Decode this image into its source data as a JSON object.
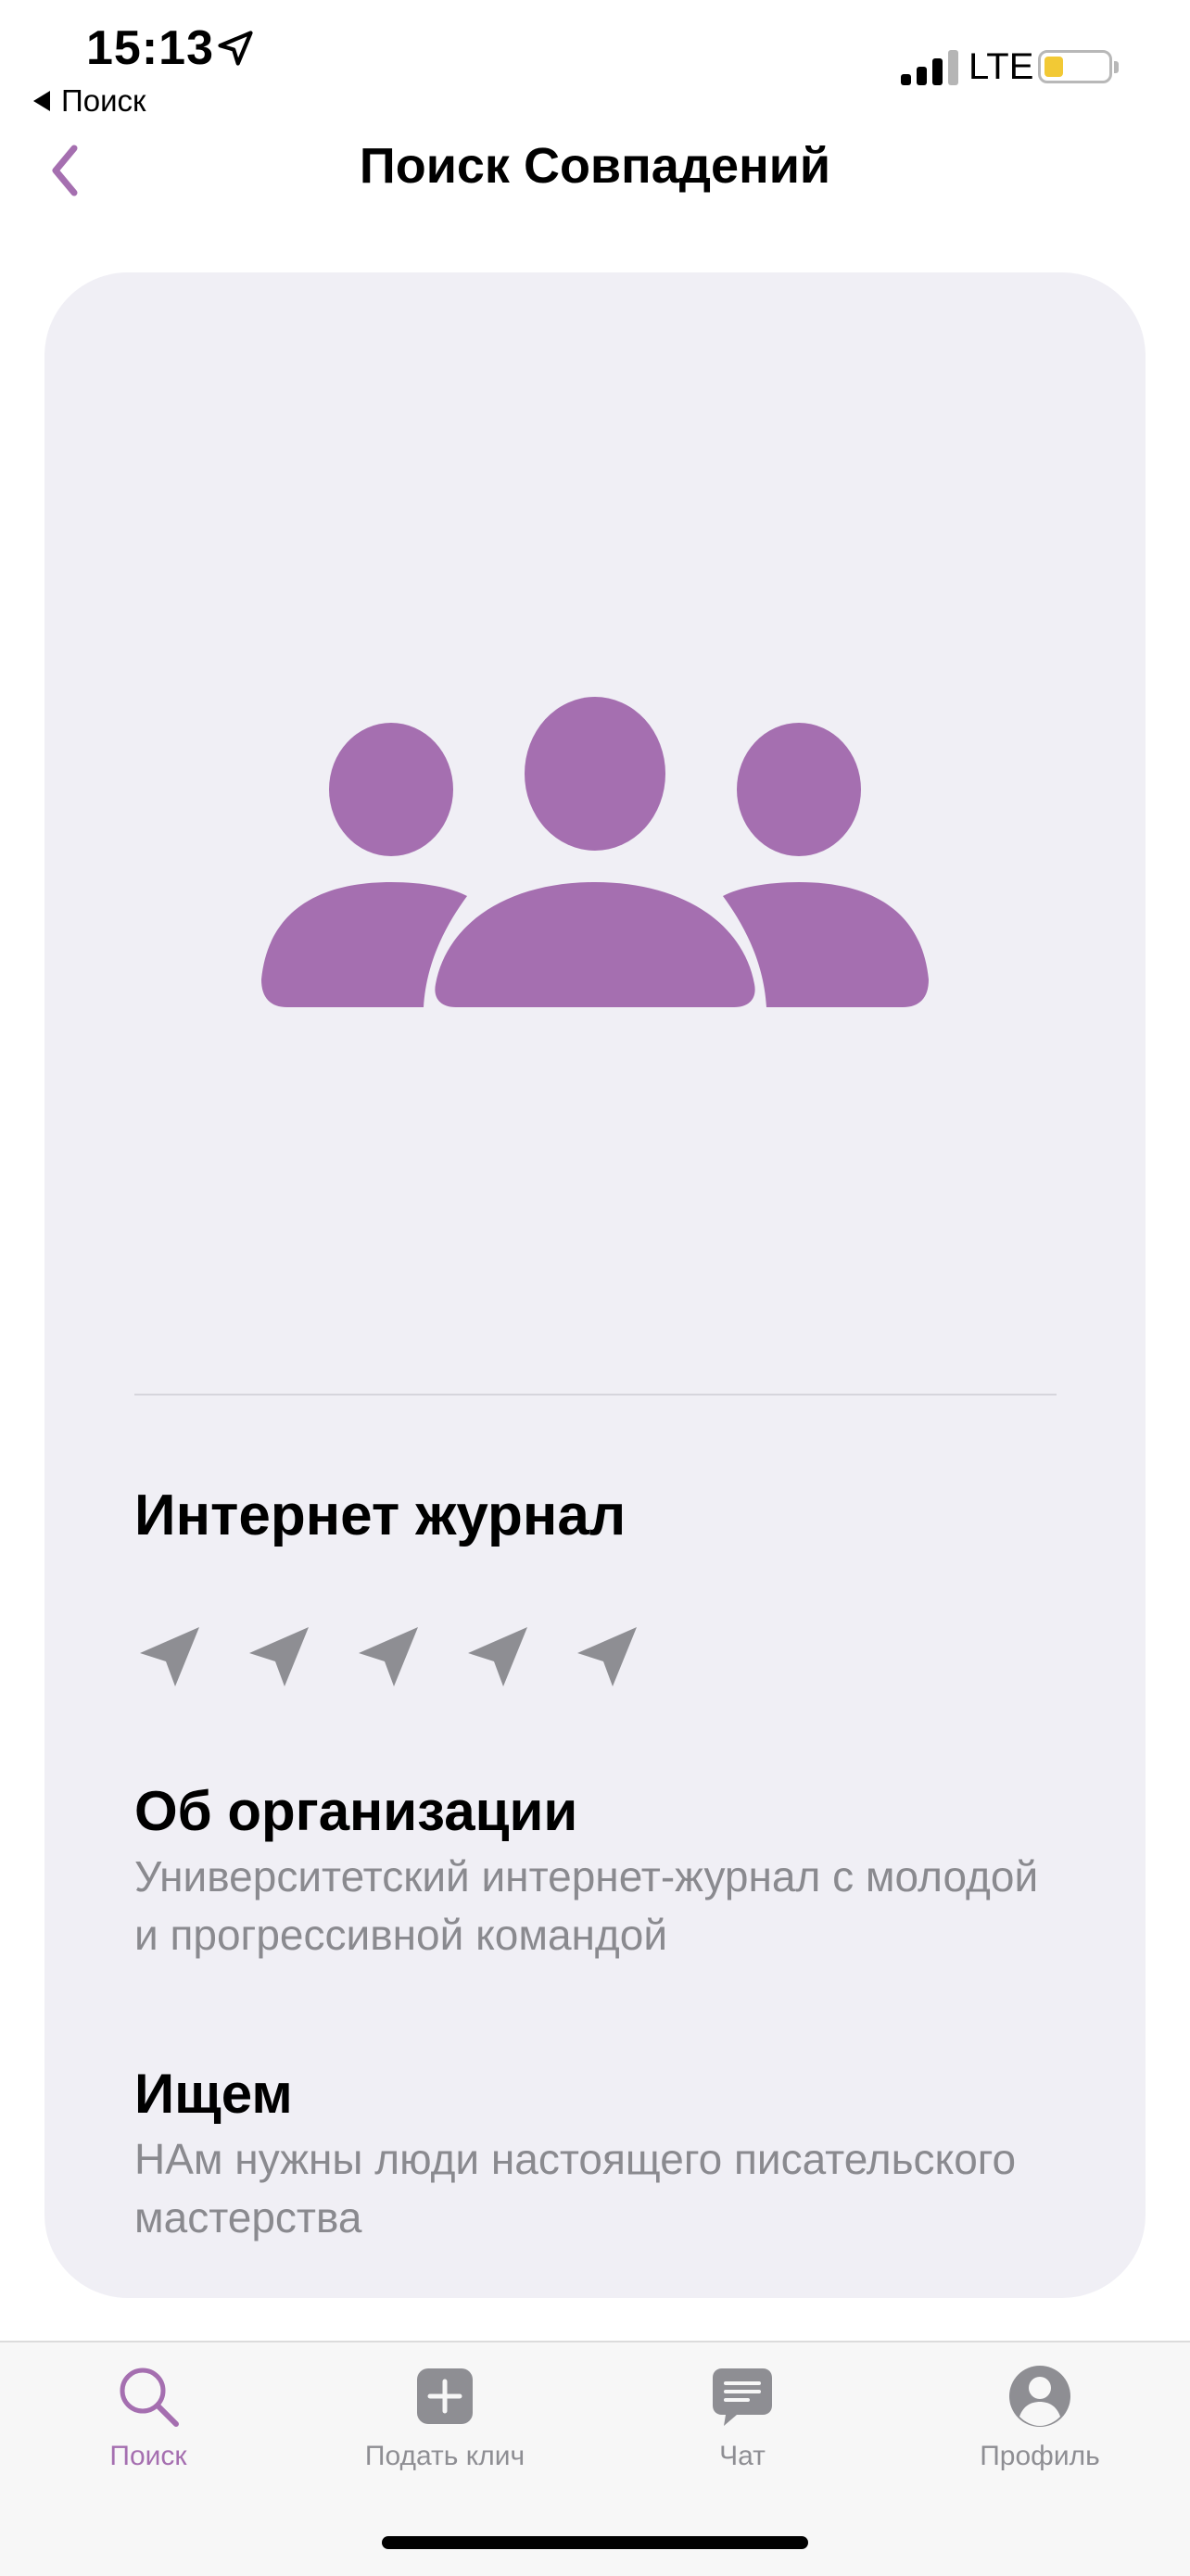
{
  "status_bar": {
    "time": "15:13",
    "back_app": "Поиск",
    "network": "LTE",
    "battery_color": "#f2c935"
  },
  "nav": {
    "title": "Поиск Совпадений",
    "back_icon": "chevron-left-icon"
  },
  "card": {
    "image_icon": "group-people-icon",
    "org_name": "Интернет журнал",
    "rating": {
      "icon": "paper-plane-icon",
      "count": 5
    },
    "about": {
      "title": "Об организации",
      "text": "Университетский интернет-журнал с молодой и прогрессивной командой"
    },
    "seeking": {
      "title": "Ищем",
      "text": "НАм нужны люди настоящего писательского мастерства"
    }
  },
  "tabbar": {
    "tabs": [
      {
        "label": "Поиск",
        "icon": "search-icon",
        "active": true
      },
      {
        "label": "Подать клич",
        "icon": "plus-square-icon",
        "active": false
      },
      {
        "label": "Чат",
        "icon": "chat-bubble-icon",
        "active": false
      },
      {
        "label": "Профиль",
        "icon": "profile-icon",
        "active": false
      }
    ]
  },
  "colors": {
    "accent": "#a56fb0",
    "card_background": "#f0eff5",
    "secondary_text": "#8a8a8f",
    "inactive_icon": "#8e8e93"
  }
}
